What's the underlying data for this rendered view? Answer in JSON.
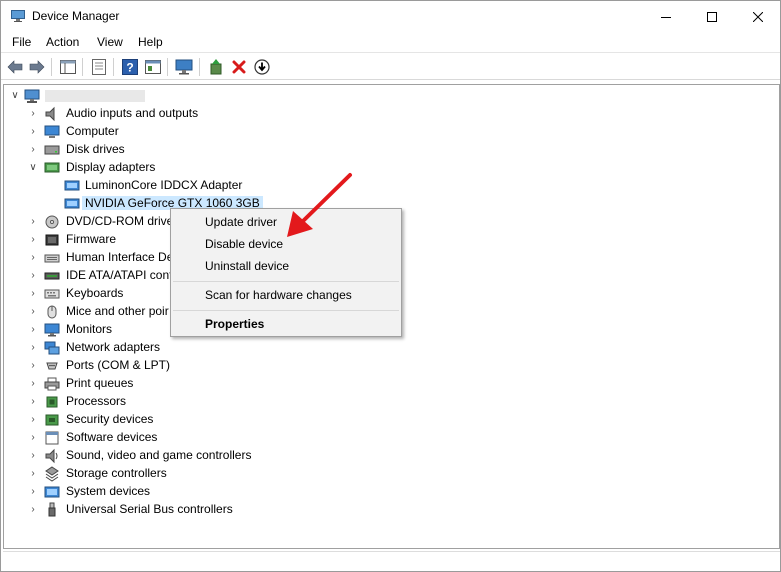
{
  "window": {
    "title": "Device Manager",
    "controls": {
      "minimize": "minimize",
      "maximize": "maximize",
      "close": "close"
    }
  },
  "menubar": {
    "items": [
      "File",
      "Action",
      "View",
      "Help"
    ]
  },
  "toolbar": {
    "buttons": [
      "back-icon",
      "forward-icon",
      "properties-grid-icon",
      "document-icon",
      "help-icon",
      "console-icon",
      "monitor-icon",
      "update-driver-icon",
      "uninstall-icon",
      "download-icon"
    ]
  },
  "tree": {
    "root_label": "",
    "categories": [
      {
        "label": "Audio inputs and outputs",
        "icon": "speaker-icon",
        "expanded": false
      },
      {
        "label": "Computer",
        "icon": "computer-icon",
        "expanded": false
      },
      {
        "label": "Disk drives",
        "icon": "disk-icon",
        "expanded": false
      },
      {
        "label": "Display adapters",
        "icon": "display-adapter-icon",
        "expanded": true,
        "children": [
          {
            "label": "LuminonCore IDDCX Adapter",
            "icon": "display-adapter-icon"
          },
          {
            "label": "NVIDIA GeForce GTX 1060 3GB",
            "icon": "display-adapter-icon",
            "selected": true
          }
        ]
      },
      {
        "label": "DVD/CD-ROM drive",
        "icon": "dvd-icon",
        "expanded": false
      },
      {
        "label": "Firmware",
        "icon": "firmware-icon",
        "expanded": false
      },
      {
        "label": "Human Interface De",
        "icon": "hid-icon",
        "expanded": false
      },
      {
        "label": "IDE ATA/ATAPI contr",
        "icon": "ide-icon",
        "expanded": false
      },
      {
        "label": "Keyboards",
        "icon": "keyboard-icon",
        "expanded": false
      },
      {
        "label": "Mice and other poir",
        "icon": "mouse-icon",
        "expanded": false
      },
      {
        "label": "Monitors",
        "icon": "monitor-icon",
        "expanded": false
      },
      {
        "label": "Network adapters",
        "icon": "network-icon",
        "expanded": false
      },
      {
        "label": "Ports (COM & LPT)",
        "icon": "port-icon",
        "expanded": false
      },
      {
        "label": "Print queues",
        "icon": "printer-icon",
        "expanded": false
      },
      {
        "label": "Processors",
        "icon": "processor-icon",
        "expanded": false
      },
      {
        "label": "Security devices",
        "icon": "security-icon",
        "expanded": false
      },
      {
        "label": "Software devices",
        "icon": "software-icon",
        "expanded": false
      },
      {
        "label": "Sound, video and game controllers",
        "icon": "speaker-icon",
        "expanded": false
      },
      {
        "label": "Storage controllers",
        "icon": "storage-icon",
        "expanded": false
      },
      {
        "label": "System devices",
        "icon": "system-icon",
        "expanded": false
      },
      {
        "label": "Universal Serial Bus controllers",
        "icon": "usb-icon",
        "expanded": false
      }
    ]
  },
  "context_menu": {
    "items": [
      "Update driver",
      "Disable device",
      "Uninstall device",
      "Scan for hardware changes",
      "Properties"
    ]
  },
  "colors": {
    "selection": "#cce8ff",
    "menu_bg": "#f2f2f2",
    "arrow": "#e3191c"
  }
}
